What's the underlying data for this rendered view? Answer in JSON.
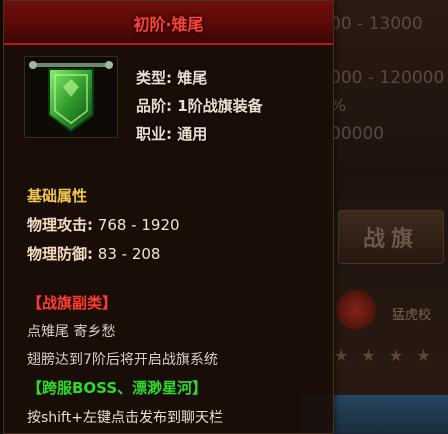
{
  "background": {
    "lines": [
      "00 - 13000",
      "000 - 120000",
      "%",
      "00000"
    ],
    "battle_flag_button": "战旗",
    "emblem_label": "猛虎校",
    "stars": "★ ★ ★ ★"
  },
  "tooltip": {
    "title": "初阶·雉尾",
    "icon": "green-war-banner-icon",
    "meta": [
      {
        "label": "类型:",
        "value": "雉尾"
      },
      {
        "label": "品阶:",
        "value": "1阶战旗装备"
      },
      {
        "label": "职业:",
        "value": "通用"
      }
    ],
    "base_section": "基础属性",
    "stats": [
      {
        "label": "物理攻击:",
        "value": "768 - 1920"
      },
      {
        "label": "物理防御:",
        "value": "83 - 208"
      }
    ],
    "set_title": "【战旗副类】",
    "set_desc": "点雉尾 寄乡愁",
    "unlock_text": "翅膀达到7阶后将开启战旗系统",
    "source": "【跨服BOSS、漂渺星河】",
    "shift_hint": "按shift+左键点击发布到聊天栏"
  },
  "colors": {
    "title_red": "#ff4236",
    "section_gold": "#f2c84a",
    "set_red": "#ff3b2c",
    "source_green": "#2bdc2b"
  }
}
